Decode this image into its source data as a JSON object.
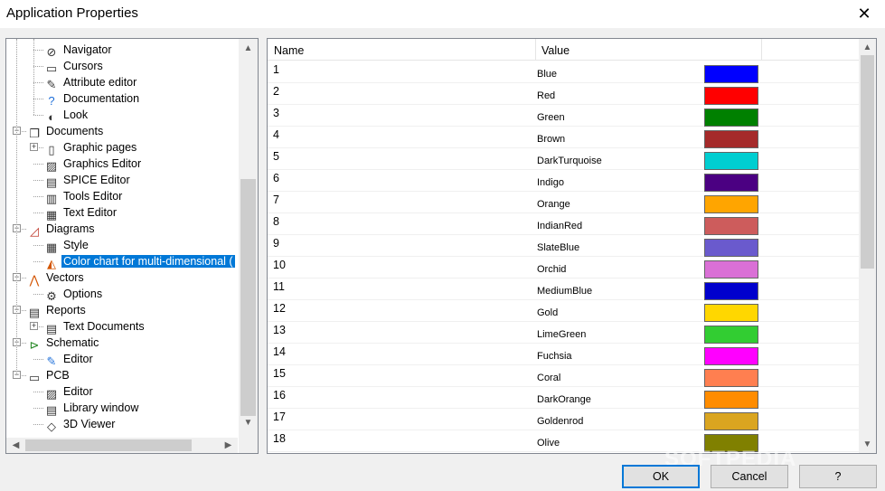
{
  "window": {
    "title": "Application Properties",
    "close_symbol": "✕"
  },
  "tree": {
    "items": [
      {
        "label": "Navigator",
        "icon": "compass-icon"
      },
      {
        "label": "Cursors",
        "icon": "cursors-icon"
      },
      {
        "label": "Attribute editor",
        "icon": "attribute-editor-icon"
      },
      {
        "label": "Documentation",
        "icon": "help-icon"
      },
      {
        "label": "Look",
        "icon": "look-icon"
      },
      {
        "label": "Documents",
        "icon": "documents-icon",
        "expander": "−"
      },
      {
        "label": "Graphic pages",
        "icon": "page-icon",
        "expander": "+"
      },
      {
        "label": "Graphics Editor",
        "icon": "graphics-editor-icon"
      },
      {
        "label": "SPICE Editor",
        "icon": "spice-editor-icon"
      },
      {
        "label": "Tools Editor",
        "icon": "tools-editor-icon"
      },
      {
        "label": "Text Editor",
        "icon": "text-editor-icon"
      },
      {
        "label": "Diagrams",
        "icon": "diagram-icon",
        "expander": "−"
      },
      {
        "label": "Style",
        "icon": "style-icon"
      },
      {
        "label": "Color chart for multi-dimensional (",
        "icon": "color-chart-icon",
        "selected": true
      },
      {
        "label": "Vectors",
        "icon": "vectors-icon",
        "expander": "−"
      },
      {
        "label": "Options",
        "icon": "options-icon"
      },
      {
        "label": "Reports",
        "icon": "reports-icon",
        "expander": "−"
      },
      {
        "label": "Text Documents",
        "icon": "text-documents-icon",
        "expander": "+"
      },
      {
        "label": "Schematic",
        "icon": "schematic-icon",
        "expander": "−"
      },
      {
        "label": "Editor",
        "icon": "schematic-editor-icon"
      },
      {
        "label": "PCB",
        "icon": "pcb-icon",
        "expander": "−"
      },
      {
        "label": "Editor",
        "icon": "pcb-editor-icon"
      },
      {
        "label": "Library window",
        "icon": "library-window-icon"
      },
      {
        "label": "3D Viewer",
        "icon": "3d-viewer-icon"
      }
    ]
  },
  "grid": {
    "columns": [
      "Name",
      "Value"
    ],
    "rows": [
      {
        "name": "1",
        "value": "Blue",
        "color": "#0000FF"
      },
      {
        "name": "2",
        "value": "Red",
        "color": "#FF0000"
      },
      {
        "name": "3",
        "value": "Green",
        "color": "#008000"
      },
      {
        "name": "4",
        "value": "Brown",
        "color": "#A52A2A"
      },
      {
        "name": "5",
        "value": "DarkTurquoise",
        "color": "#00CED1"
      },
      {
        "name": "6",
        "value": "Indigo",
        "color": "#4B0082"
      },
      {
        "name": "7",
        "value": "Orange",
        "color": "#FFA500"
      },
      {
        "name": "8",
        "value": "IndianRed",
        "color": "#CD5C5C"
      },
      {
        "name": "9",
        "value": "SlateBlue",
        "color": "#6A5ACD"
      },
      {
        "name": "10",
        "value": "Orchid",
        "color": "#DA70D6"
      },
      {
        "name": "11",
        "value": "MediumBlue",
        "color": "#0000CD"
      },
      {
        "name": "12",
        "value": "Gold",
        "color": "#FFD700"
      },
      {
        "name": "13",
        "value": "LimeGreen",
        "color": "#32CD32"
      },
      {
        "name": "14",
        "value": "Fuchsia",
        "color": "#FF00FF"
      },
      {
        "name": "15",
        "value": "Coral",
        "color": "#FF7F50"
      },
      {
        "name": "16",
        "value": "DarkOrange",
        "color": "#FF8C00"
      },
      {
        "name": "17",
        "value": "Goldenrod",
        "color": "#DAA520"
      },
      {
        "name": "18",
        "value": "Olive",
        "color": "#808000"
      }
    ]
  },
  "buttons": {
    "ok": "OK",
    "cancel": "Cancel",
    "help": "?"
  },
  "watermark": "SOFTPEDIA"
}
